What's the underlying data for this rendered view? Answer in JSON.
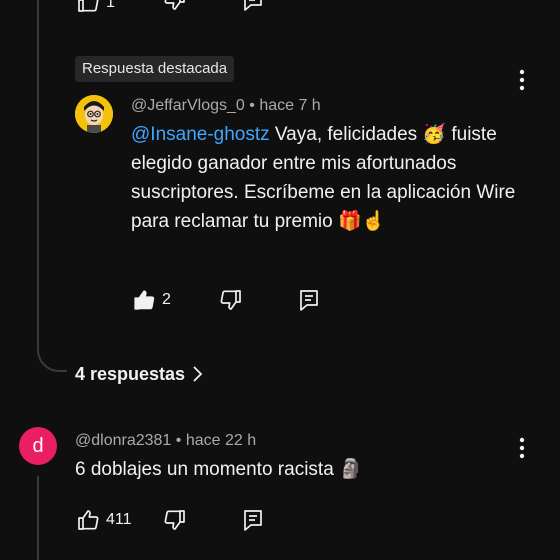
{
  "top_actions": {
    "like_count": "1"
  },
  "featured_reply": {
    "badge": "Respuesta destacada",
    "author": "@JeffarVlogs_0",
    "separator": "•",
    "time": "hace 7 h",
    "mention": "@Insane-ghostz",
    "text": " Vaya, felicidades 🥳 fuiste elegido ganador entre mis afortunados suscriptores. Escríbeme en la aplicación Wire para reclamar tu premio 🎁☝️",
    "like_count": "2",
    "icons": [
      "more-vert-icon",
      "like-icon",
      "dislike-icon",
      "reply-icon"
    ]
  },
  "replies_link": {
    "label": "4 respuestas",
    "icon": "chevron-right-icon"
  },
  "comment": {
    "avatar_letter": "d",
    "avatar_color": "#e91e63",
    "author": "@dlonra2381",
    "separator": "•",
    "time": "hace 22 h",
    "text": "6 doblajes un momento racista 🗿",
    "like_count": "411"
  },
  "colors": {
    "background": "#0f0f0f",
    "mention": "#3ea6ff",
    "meta": "#aaaaaa",
    "thread_line": "#3a3a3a"
  }
}
